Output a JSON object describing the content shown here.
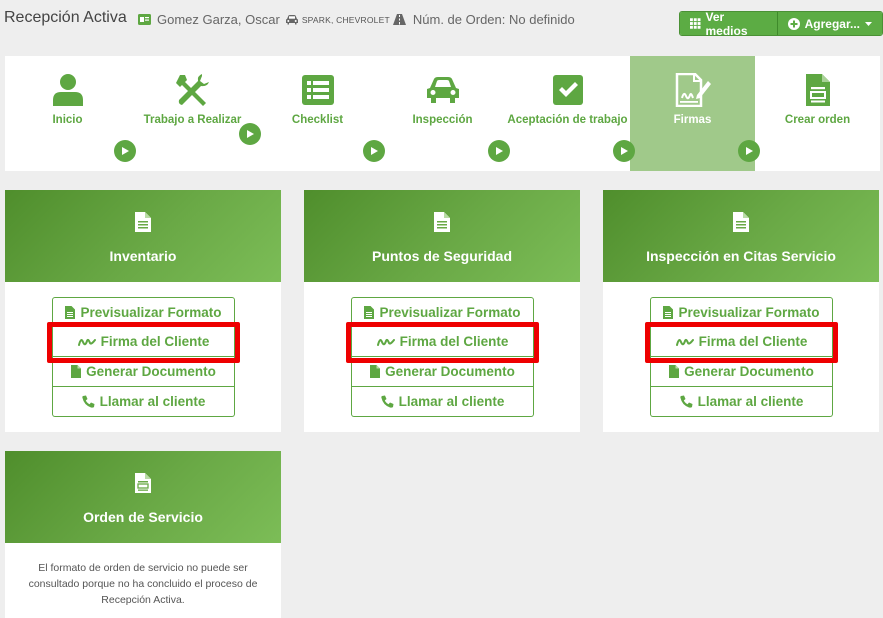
{
  "header": {
    "title": "Recepción Activa",
    "client_name": "Gomez Garza, Oscar",
    "vehicle": "SPARK, CHEVROLET",
    "order_label": "Núm. de Orden: No definido",
    "ver_medios_label": "Ver medios",
    "agregar_label": "Agregar..."
  },
  "steps": [
    {
      "label": "Inicio",
      "icon": "user-icon"
    },
    {
      "label": "Trabajo a Realizar",
      "icon": "tools-icon"
    },
    {
      "label": "Checklist",
      "icon": "list-icon"
    },
    {
      "label": "Inspección",
      "icon": "car-icon"
    },
    {
      "label": "Aceptación de trabajo",
      "icon": "checkbox-icon"
    },
    {
      "label": "Firmas",
      "icon": "signature-icon",
      "active": true
    },
    {
      "label": "Crear orden",
      "icon": "document-icon"
    }
  ],
  "cards": [
    {
      "title": "Inventario",
      "actions": [
        "Previsualizar Formato",
        "Firma del Cliente",
        "Generar Documento",
        "Llamar al cliente"
      ]
    },
    {
      "title": "Puntos de Seguridad",
      "actions": [
        "Previsualizar Formato",
        "Firma del Cliente",
        "Generar Documento",
        "Llamar al cliente"
      ]
    },
    {
      "title": "Inspección en Citas Servicio",
      "actions": [
        "Previsualizar Formato",
        "Firma del Cliente",
        "Generar Documento",
        "Llamar al cliente"
      ]
    },
    {
      "title": "Orden de Servicio",
      "message": "El formato de orden de servicio no puede ser consultado porque no ha concluido el proceso de Recepción Activa."
    }
  ],
  "colors": {
    "brand_green": "#5ea742",
    "active_step": "#a0c98a",
    "highlight": "#ee0000"
  }
}
